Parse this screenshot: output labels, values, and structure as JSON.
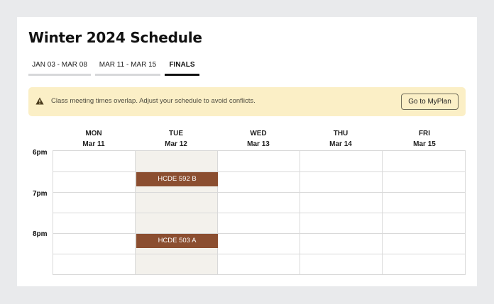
{
  "page": {
    "title": "Winter 2024 Schedule"
  },
  "tabs": [
    {
      "label": "JAN 03 - MAR 08",
      "active": false
    },
    {
      "label": "MAR 11 - MAR 15",
      "active": false
    },
    {
      "label": "FINALS",
      "active": true
    }
  ],
  "banner": {
    "icon": "warning-icon",
    "message": "Class meeting times overlap. Adjust your schedule to avoid conflicts.",
    "button_label": "Go to MyPlan"
  },
  "days": [
    {
      "day": "MON",
      "date": "Mar 11"
    },
    {
      "day": "TUE",
      "date": "Mar 12"
    },
    {
      "day": "WED",
      "date": "Mar 13"
    },
    {
      "day": "THU",
      "date": "Mar 14"
    },
    {
      "day": "FRI",
      "date": "Mar 15"
    }
  ],
  "times": [
    "6pm",
    "7pm",
    "8pm"
  ],
  "events": [
    {
      "label": "HCDE 592 B",
      "day": "TUE"
    },
    {
      "label": "HCDE 503 A",
      "day": "TUE"
    }
  ],
  "colors": {
    "event": "#8b4e30",
    "banner": "#fbefc6",
    "highlight_column": "#f3f1ec"
  }
}
